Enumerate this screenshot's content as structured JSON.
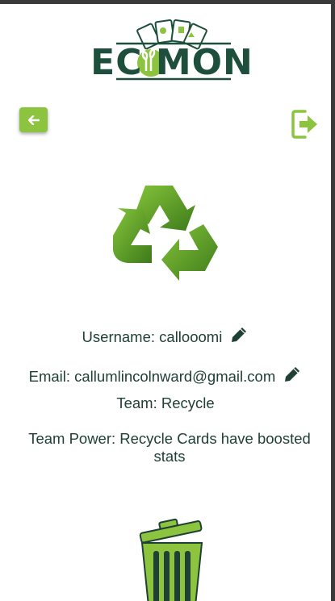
{
  "app": {
    "logo_text": "EC MON"
  },
  "nav": {
    "back_icon": "arrow-left-icon",
    "logout_icon": "sign-out-icon"
  },
  "profile": {
    "team_icon": "recycle-icon",
    "username_text": "Username: callooomi",
    "email_text": "Email: callumlincolnward@gmail.com",
    "team_text": "Team: Recycle",
    "team_power_text": "Team Power: Recycle Cards have boosted stats",
    "edit_icon": "pencil-icon",
    "delete_icon": "trash-bin-icon"
  },
  "colors": {
    "brand_dark": "#1d4f3c",
    "accent_green": "#8cc43f",
    "recycle_dark": "#3f7f1a",
    "recycle_light": "#7cbf2e"
  }
}
